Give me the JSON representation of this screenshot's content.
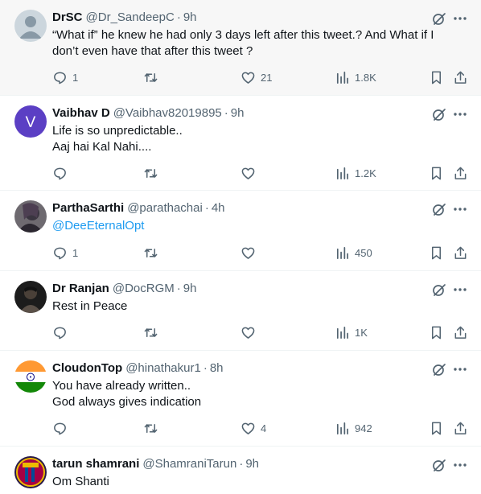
{
  "tweets": [
    {
      "name": "DrSC",
      "handle": "@Dr_SandeepC",
      "time": "9h",
      "lines": [
        "“What if” he knew he had only 3 days left after this tweet.? And What if I",
        "don’t even have that after this tweet ?"
      ],
      "replies": "1",
      "retweets": "",
      "likes": "21",
      "views": "1.8K",
      "avatar": "default-avatar-icon",
      "highlighted": true
    },
    {
      "name": "Vaibhav D",
      "handle": "@Vaibhav82019895",
      "time": "9h",
      "lines": [
        "Life is so unpredictable..",
        "Aaj hai Kal Nahi...."
      ],
      "replies": "",
      "retweets": "",
      "likes": "",
      "views": "1.2K",
      "avatar_letter": "V",
      "avatar_color": "#5b3fc4"
    },
    {
      "name": "ParthaSarthi",
      "handle": "@parathachai",
      "time": "4h",
      "lines": [
        "@DeeEternalOpt"
      ],
      "replies": "1",
      "retweets": "",
      "likes": "",
      "views": "450",
      "avatar": "photo-avatar"
    },
    {
      "name": "Dr Ranjan",
      "handle": "@DocRGM",
      "time": "9h",
      "lines": [
        "Rest in Peace"
      ],
      "replies": "",
      "retweets": "",
      "likes": "",
      "views": "1K",
      "avatar": "photo-avatar"
    },
    {
      "name": "CloudonTop",
      "handle": "@hinathakur1",
      "time": "8h",
      "lines": [
        "You have already written..",
        "God always gives indication"
      ],
      "replies": "",
      "retweets": "",
      "likes": "4",
      "views": "942",
      "avatar": "india-flag-avatar"
    },
    {
      "name": "tarun shamrani",
      "handle": "@ShamraniTarun",
      "time": "9h",
      "lines": [
        "Om Shanti"
      ],
      "avatar": "club-crest-avatar"
    }
  ],
  "separator": "·",
  "colors": {
    "link": "#1d9bf0",
    "muted": "#536471",
    "text": "#0f1419",
    "highlight_bg": "#f7f7f7"
  }
}
